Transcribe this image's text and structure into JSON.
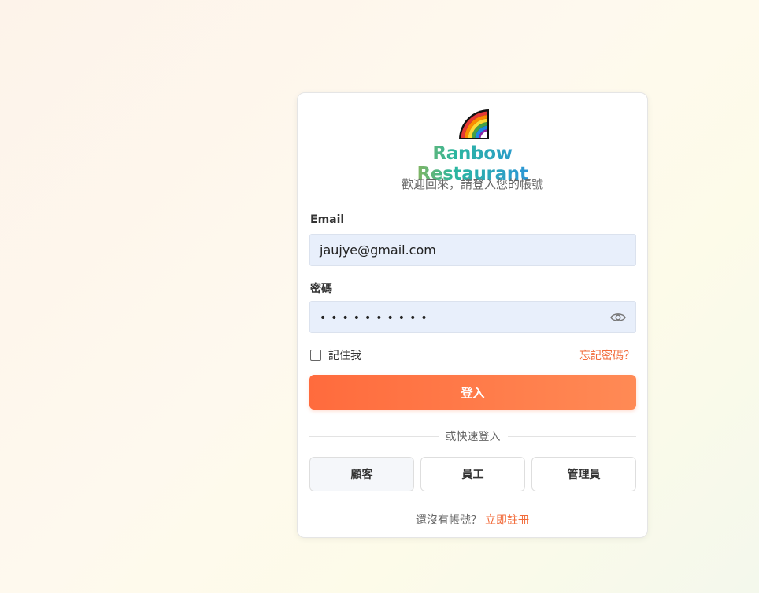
{
  "brand": {
    "logo_icon": "rainbow-icon",
    "name": "Ranbow Restaurant",
    "subtitle": "歡迎回來，請登入您的帳號"
  },
  "form": {
    "email_label": "Email",
    "email_value": "jaujye@gmail.com",
    "password_label": "密碼",
    "password_mask": "••••••••••",
    "remember_label": "記住我",
    "remember_checked": false,
    "forgot_label": "忘記密碼？",
    "submit_label": "登入"
  },
  "quick_login": {
    "divider_text": "或快速登入",
    "buttons": [
      "顧客",
      "員工",
      "管理員"
    ]
  },
  "signup": {
    "prompt": "還沒有帳號？",
    "link": "立即註冊"
  },
  "colors": {
    "accent": "#ff6b3d",
    "link": "#f26b3a",
    "input_bg": "#e8effb"
  }
}
